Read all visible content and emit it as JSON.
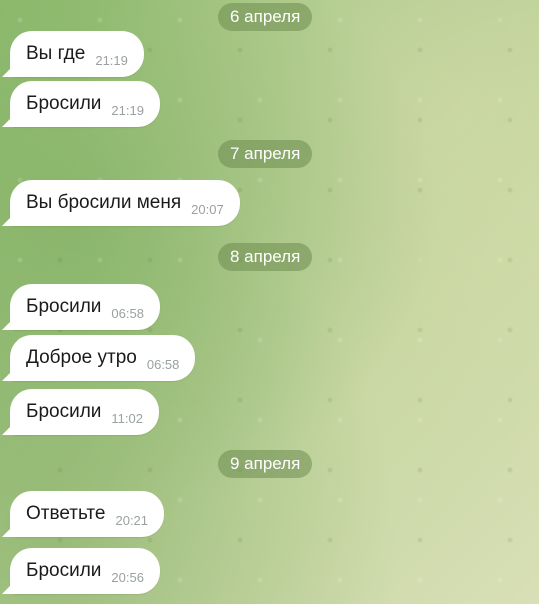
{
  "chat": {
    "groups": [
      {
        "date": "6 апреля",
        "messages": [
          {
            "text": "Вы где",
            "time": "21:19"
          },
          {
            "text": "Бросили",
            "time": "21:19"
          }
        ]
      },
      {
        "date": "7 апреля",
        "messages": [
          {
            "text": "Вы бросили меня",
            "time": "20:07"
          }
        ]
      },
      {
        "date": "8 апреля",
        "messages": [
          {
            "text": "Бросили",
            "time": "06:58"
          },
          {
            "text": "Доброе утро",
            "time": "06:58"
          },
          {
            "text": "Бросили",
            "time": "11:02"
          }
        ]
      },
      {
        "date": "9 апреля",
        "messages": [
          {
            "text": "Ответьте",
            "time": "20:21"
          },
          {
            "text": "Бросили",
            "time": "20:56"
          }
        ]
      }
    ]
  }
}
